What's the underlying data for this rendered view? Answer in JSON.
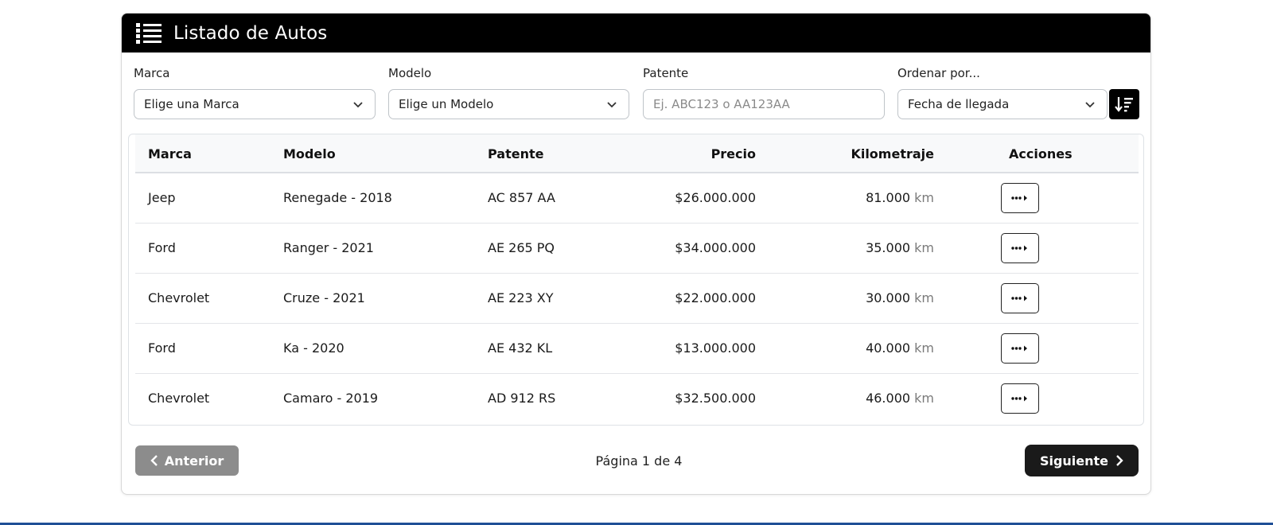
{
  "header": {
    "title": "Listado de Autos",
    "icon": "list-icon"
  },
  "filters": {
    "brand": {
      "label": "Marca",
      "value": "Elige una Marca"
    },
    "model": {
      "label": "Modelo",
      "value": "Elige un Modelo"
    },
    "plate": {
      "label": "Patente",
      "placeholder": "Ej. ABC123 o AA123AA"
    },
    "order": {
      "label": "Ordenar por...",
      "value": "Fecha de llegada"
    },
    "sort_icon": "sort-descending-icon"
  },
  "table": {
    "columns": [
      "Marca",
      "Modelo",
      "Patente",
      "Precio",
      "Kilometraje",
      "Acciones"
    ],
    "km_unit": "km",
    "rows": [
      {
        "brand": "Jeep",
        "model": "Renegade - 2018",
        "plate": "AC 857 AA",
        "price": "$26.000.000",
        "km": "81.000"
      },
      {
        "brand": "Ford",
        "model": "Ranger - 2021",
        "plate": "AE 265 PQ",
        "price": "$34.000.000",
        "km": "35.000"
      },
      {
        "brand": "Chevrolet",
        "model": "Cruze - 2021",
        "plate": "AE 223 XY",
        "price": "$22.000.000",
        "km": "30.000"
      },
      {
        "brand": "Ford",
        "model": "Ka - 2020",
        "plate": "AE 432 KL",
        "price": "$13.000.000",
        "km": "40.000"
      },
      {
        "brand": "Chevrolet",
        "model": "Camaro - 2019",
        "plate": "AD 912 RS",
        "price": "$32.500.000",
        "km": "46.000"
      }
    ]
  },
  "pagination": {
    "prev_label": "Anterior",
    "next_label": "Siguiente",
    "page_info": "Página 1 de 4"
  },
  "colors": {
    "header_bg": "#000000",
    "prev_disabled": "#8c8c8c",
    "next_bg": "#1a1a1a",
    "bottom_bar": "#1f4f96"
  }
}
